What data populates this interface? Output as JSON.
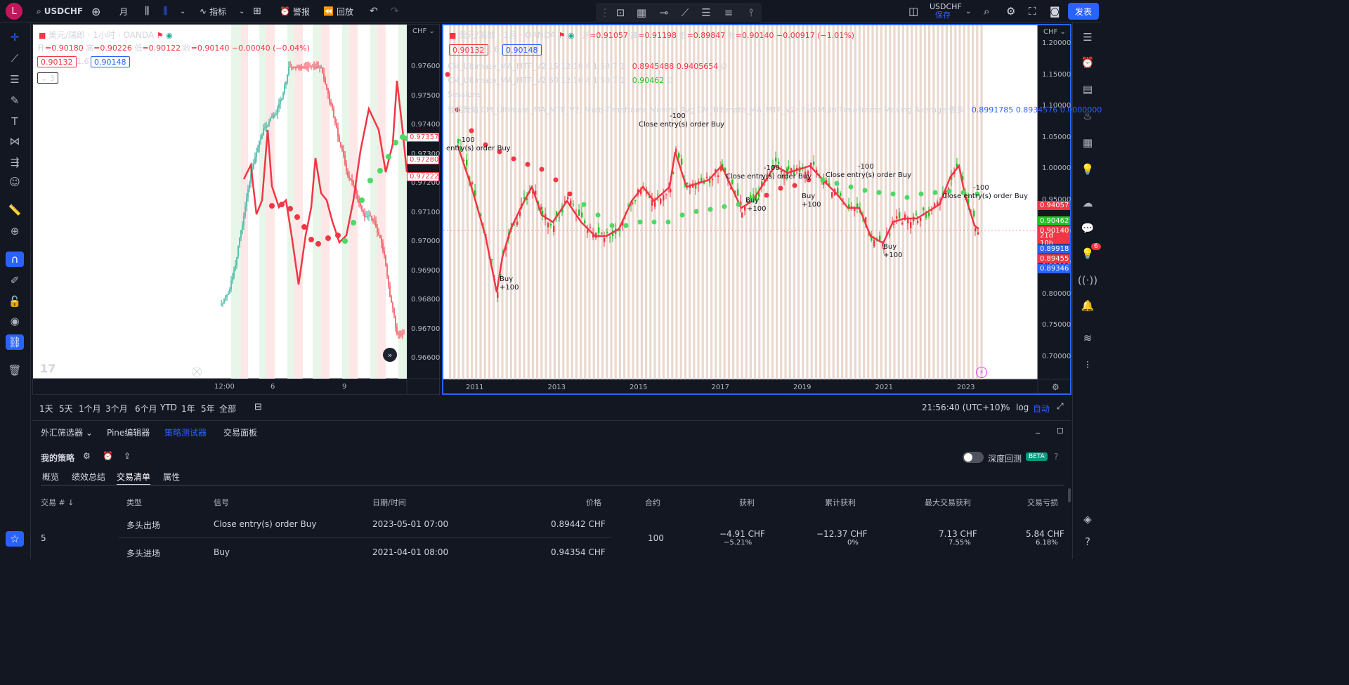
{
  "topbar": {
    "avatar": "L",
    "symbol": "USDCHF",
    "interval": "月",
    "indicators": "指标",
    "alert": "警报",
    "replay": "回放",
    "right_symbol": "USDCHF",
    "saved": "保存",
    "publish": "发表"
  },
  "pane1": {
    "title": "美元/瑞郎 · 1小时 · OANDA",
    "open_lbl": "开",
    "open": "=0.90180",
    "high_lbl": "高",
    "high": "=0.90226",
    "low_lbl": "低",
    "low": "=0.90122",
    "close_lbl": "收",
    "close": "=0.90140",
    "change": "−0.00040 (−0.04%)",
    "bid": "0.90132",
    "spread": "1.6",
    "ask": "0.90148",
    "collapsed": "3",
    "currency": "CHF",
    "price_ticks": [
      "0.97600",
      "0.97500",
      "0.97400",
      "0.97300",
      "0.97200",
      "0.97100",
      "0.97000",
      "0.96900",
      "0.96800",
      "0.96700",
      "0.96600"
    ],
    "price_labels": [
      "0.97357",
      "0.97280",
      "0.97222"
    ],
    "time_ticks": [
      "12:00",
      "6",
      "9"
    ]
  },
  "pane2": {
    "title": "美元/瑞郎 · 1月 · OANDA",
    "open_lbl": "开",
    "open": "=0.91057",
    "high_lbl": "高",
    "high": "=0.91198",
    "low_lbl": "低",
    "low": "=0.89847",
    "close_lbl": "收",
    "close": "=0.90140",
    "change": "−0.00917 (−1.01%)",
    "bid": "0.90132",
    "spread": "1.6",
    "ask": "0.90148",
    "ind1": "CM_Ultimate_MA_MTF_V2 15 12 10 4 1 50 7 1",
    "ind1_v1": "0.8945488",
    "ind1_v2": "0.9405654",
    "ind1_v3": "∅",
    "ind2": "CM_Ultimate_MA_MTF_V2 60 12 10 4 1 50 7 1",
    "ind2_v1": "0.90462",
    "ind2_v2": "∅",
    "ind3": "Sessions",
    "ind4": "我的策略 CM_Ultimate_MA_MTF_V2: Multi-Timeframe Moving Avg CM_Ultimate_MA_MTF_V2: 2nd Multi-TimeFrame Moving Average 做多",
    "ind4_v1": "0.8991785",
    "ind4_v2": "0.8934576",
    "ind4_v3": "0.0000000",
    "ind4_more": "...",
    "currency": "CHF",
    "price_ticks": [
      "1.20000",
      "1.15000",
      "1.10000",
      "1.05000",
      "1.00000",
      "0.95000",
      "0.90000",
      "0.85000",
      "0.80000",
      "0.75000",
      "0.70000"
    ],
    "price_labels": [
      {
        "v": "0.94057",
        "c": "#f23645"
      },
      {
        "v": "0.90462",
        "c": "#22c322"
      },
      {
        "v": "0.90140",
        "c": "#f23645"
      },
      {
        "v": "21d 10h",
        "c": "#f23645"
      },
      {
        "v": "0.89918",
        "c": "#2962ff"
      },
      {
        "v": "0.89455",
        "c": "#f23645"
      },
      {
        "v": "0.89346",
        "c": "#2962ff"
      }
    ],
    "time_ticks": [
      "2011",
      "2013",
      "2015",
      "2017",
      "2019",
      "2021",
      "2023"
    ],
    "signals": [
      "-100",
      "Close entry(s) order Buy",
      "-100",
      "entry(s) order Buy",
      "Buy",
      "+100",
      "-100",
      "Close entry(s) order Buy",
      "Buy",
      "+100",
      "Buy",
      "+100",
      "-100",
      "Close entry(s) order Buy",
      "Buy",
      "+100",
      "-100",
      "Close entry(s) order Buy"
    ]
  },
  "timebar": {
    "ranges": [
      "1天",
      "5天",
      "1个月",
      "3个月",
      "6个月",
      "YTD",
      "1年",
      "5年",
      "全部"
    ],
    "clock": "21:56:40 (UTC+10)",
    "percent": "%",
    "log": "log",
    "auto": "自动"
  },
  "panel": {
    "tabs": [
      "外汇筛选器",
      "Pine编辑器",
      "策略测试器",
      "交易面板"
    ],
    "strategy": "我的策略",
    "deep": "深度回测",
    "beta": "BETA",
    "subtabs": [
      "概览",
      "绩效总结",
      "交易清单",
      "属性"
    ],
    "headers": [
      "交易 # ↓",
      "类型",
      "信号",
      "日期/时间",
      "价格",
      "合约",
      "获利",
      "累计获利",
      "最大交易获利",
      "交易亏损"
    ],
    "trade": {
      "num": "5",
      "contracts": "100",
      "profit": "−4.91 CHF",
      "profit_pct": "−5.21%",
      "cum": "−12.37 CHF",
      "cum_pct": "0%",
      "max": "7.13 CHF",
      "max_pct": "7.55%",
      "dd": "5.84 CHF",
      "dd_pct": "6.18%",
      "rows": [
        {
          "type": "多头出场",
          "signal": "Close entry(s) order Buy",
          "date": "2023-05-01 07:00",
          "price": "0.89442 CHF"
        },
        {
          "type": "多头进场",
          "signal": "Buy",
          "date": "2021-04-01 08:00",
          "price": "0.94354 CHF"
        }
      ]
    }
  },
  "badge": "6",
  "colors": {
    "accent": "#2962ff",
    "up": "#22c322",
    "down": "#f23645"
  }
}
